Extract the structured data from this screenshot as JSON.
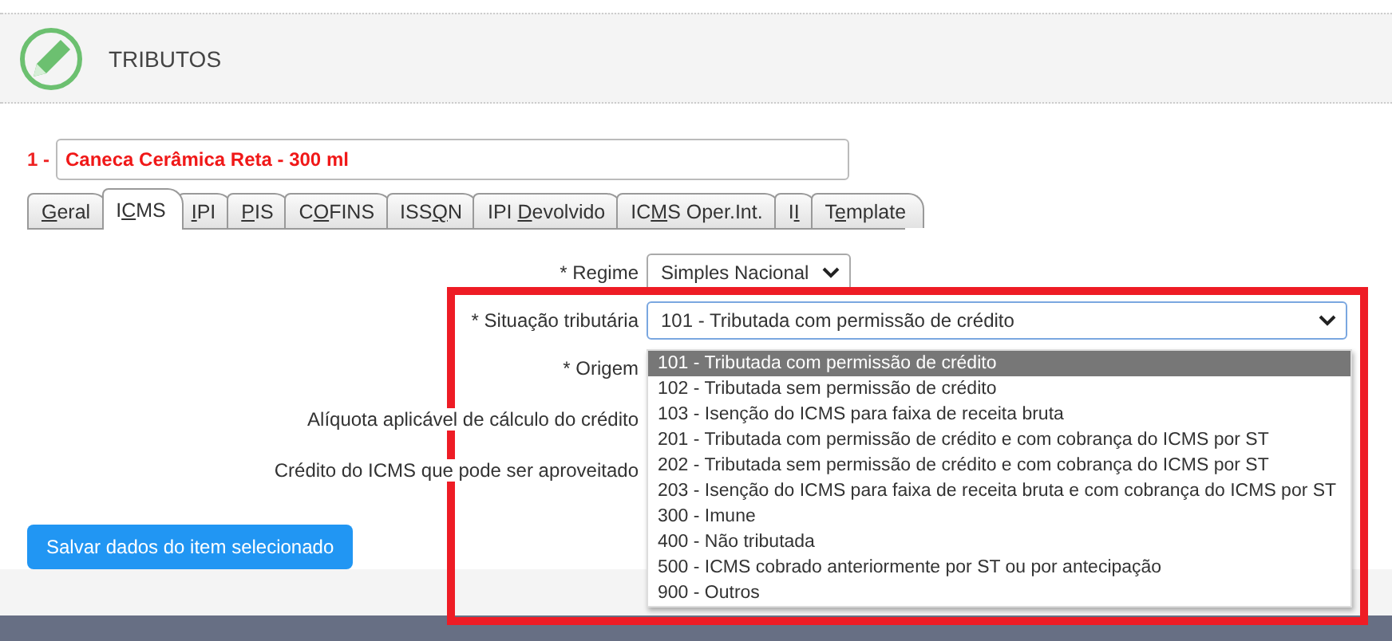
{
  "header": {
    "title": "TRIBUTOS"
  },
  "item": {
    "number": "1 -",
    "name": "Caneca Cerâmica Reta - 300 ml"
  },
  "tabs": [
    {
      "key": "G",
      "post": "eral",
      "selected": false
    },
    {
      "pre": "I",
      "key": "C",
      "post": "MS",
      "selected": true
    },
    {
      "key": "I",
      "post": "PI",
      "selected": false
    },
    {
      "key": "P",
      "post": "IS",
      "selected": false
    },
    {
      "pre": "C",
      "key": "O",
      "post": "FINS",
      "selected": false
    },
    {
      "pre": "ISS",
      "key": "Q",
      "post": "N",
      "selected": false
    },
    {
      "pre": "IPI ",
      "key": "D",
      "post": "evolvido",
      "selected": false
    },
    {
      "pre": "IC",
      "key": "M",
      "post": "S Oper.Int.",
      "selected": false
    },
    {
      "pre": "I",
      "key": "I",
      "selected": false
    },
    {
      "pre": "T",
      "key": "e",
      "post": "mplate",
      "selected": false
    }
  ],
  "fields": [
    {
      "label": "* Regime",
      "kind": "select",
      "value": "Simples Nacional"
    },
    {
      "label": "* Situação tributária",
      "kind": "wide-select",
      "value": "101 - Tributada com permissão de crédito"
    },
    {
      "label": "* Origem",
      "kind": "plain"
    },
    {
      "label": "Alíquota aplicável de cálculo do crédito",
      "kind": "plain"
    },
    {
      "label": "Crédito do ICMS que pode ser aproveitado",
      "kind": "plain"
    }
  ],
  "dropdown": {
    "options": [
      {
        "label": "101 - Tributada com permissão de crédito",
        "selected": true
      },
      {
        "label": "102 - Tributada sem permissão de crédito",
        "selected": false
      },
      {
        "label": "103 - Isenção do ICMS para faixa de receita bruta",
        "selected": false
      },
      {
        "label": "201 - Tributada com permissão de crédito e com cobrança do ICMS por ST",
        "selected": false
      },
      {
        "label": "202 - Tributada sem permissão de crédito e com cobrança do ICMS por ST",
        "selected": false
      },
      {
        "label": "203 - Isenção do ICMS para faixa de receita bruta e com cobrança do ICMS por ST",
        "selected": false
      },
      {
        "label": "300 - Imune",
        "selected": false
      },
      {
        "label": "400 - Não tributada",
        "selected": false
      },
      {
        "label": "500 - ICMS cobrado anteriormente por ST ou por antecipação",
        "selected": false
      },
      {
        "label": "900 - Outros",
        "selected": false
      }
    ]
  },
  "save_button": {
    "label": "Salvar dados do item selecionado"
  }
}
